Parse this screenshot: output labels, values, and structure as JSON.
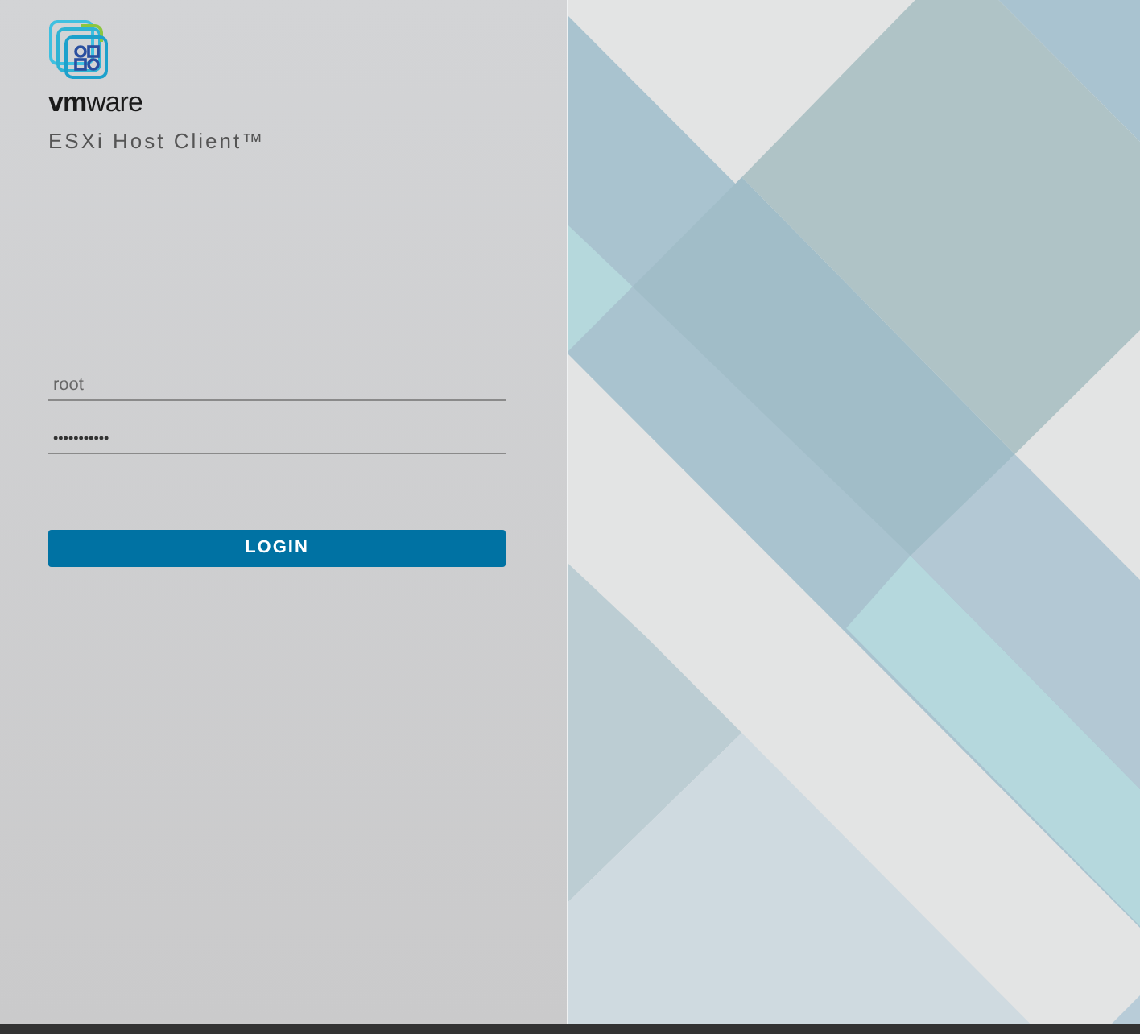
{
  "brand": {
    "logo_text": "**vm**ware",
    "product": "ESXi Host Client™"
  },
  "form": {
    "username": {
      "value": "root"
    },
    "password": {
      "value": "•••••••••••"
    },
    "submit": "LOGIN"
  }
}
